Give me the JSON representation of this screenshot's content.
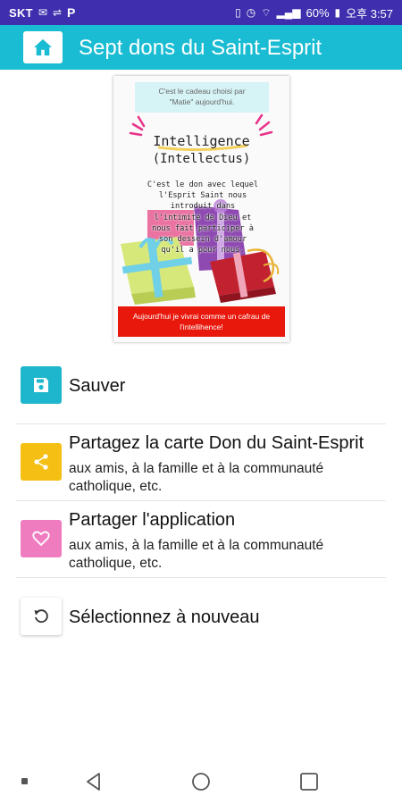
{
  "status_bar": {
    "carrier": "SKT",
    "battery": "60%",
    "time": "오후 3:57"
  },
  "app_bar": {
    "title": "Sept dons du Saint-Esprit",
    "home_icon": "home-icon",
    "accent_color": "#19bcd2"
  },
  "card": {
    "caption": "C'est le cadeau choisi par\n\"Matie\" aujourd'hui.",
    "title": "Intelligence",
    "subtitle": "(Intellectus)",
    "body": "C'est le don avec lequel l'Esprit Saint nous introduit dans l'intimité de Dieu et nous fait participer à son dessein d'amour qu'il a pour nous.",
    "banner": "Aujourd'hui je vivrai comme un cafrau de l'intellihence!"
  },
  "menu": [
    {
      "title": "Sauver",
      "subtitle": "",
      "icon": "save-icon",
      "color": "#1eb6cc"
    },
    {
      "title": "Partagez la carte Don du Saint-Esprit",
      "subtitle": "aux amis, à la famille et à la communauté catholique, etc.",
      "icon": "share-icon",
      "color": "#f6bf14"
    },
    {
      "title": "Partager l'application",
      "subtitle": "aux amis, à la famille et à la communauté catholique, etc.",
      "icon": "heart-icon",
      "color": "#f07cc0"
    },
    {
      "title": "Sélectionnez à nouveau",
      "subtitle": "",
      "icon": "refresh-icon",
      "color": "#ffffff"
    }
  ]
}
